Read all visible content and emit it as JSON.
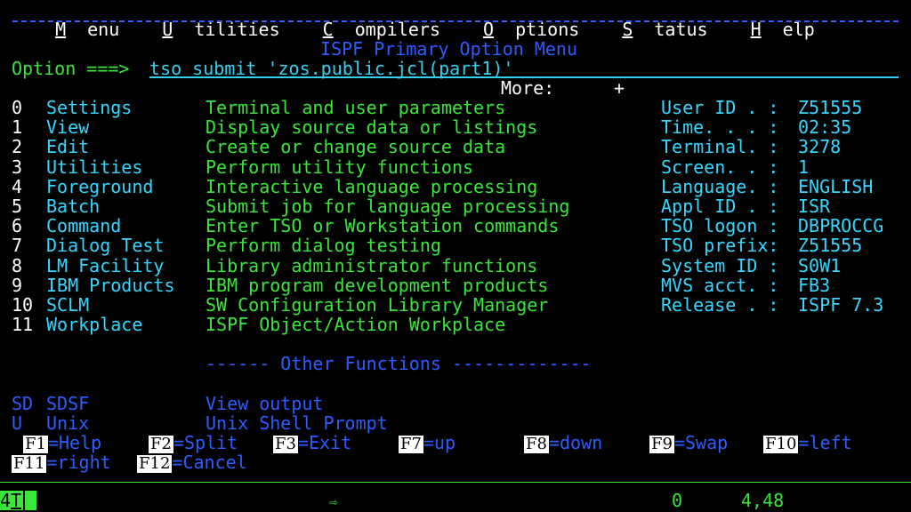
{
  "menubar": [
    {
      "mnemonic": "M",
      "rest": "enu"
    },
    {
      "mnemonic": "U",
      "rest": "tilities"
    },
    {
      "mnemonic": "C",
      "rest": "ompilers"
    },
    {
      "mnemonic": "O",
      "rest": "ptions"
    },
    {
      "mnemonic": "S",
      "rest": "tatus"
    },
    {
      "mnemonic": "H",
      "rest": "elp"
    }
  ],
  "panel_title": "ISPF Primary Option Menu",
  "option_label": "Option ===>",
  "command_value": "tso submit 'zos.public.jcl(part1)'",
  "more_label": "More:",
  "more_indicator": "+",
  "options": [
    {
      "num": "0",
      "name": "Settings",
      "desc": "Terminal and user parameters"
    },
    {
      "num": "1",
      "name": "View",
      "desc": "Display source data or listings"
    },
    {
      "num": "2",
      "name": "Edit",
      "desc": "Create or change source data"
    },
    {
      "num": "3",
      "name": "Utilities",
      "desc": "Perform utility functions"
    },
    {
      "num": "4",
      "name": "Foreground",
      "desc": "Interactive language processing"
    },
    {
      "num": "5",
      "name": "Batch",
      "desc": "Submit job for language processing"
    },
    {
      "num": "6",
      "name": "Command",
      "desc": "Enter TSO or Workstation commands"
    },
    {
      "num": "7",
      "name": "Dialog Test",
      "desc": "Perform dialog testing"
    },
    {
      "num": "8",
      "name": "LM Facility",
      "desc": "Library administrator functions"
    },
    {
      "num": "9",
      "name": "IBM Products",
      "desc": "IBM program development products"
    },
    {
      "num": "10",
      "name": "SCLM",
      "desc": "SW Configuration Library Manager"
    },
    {
      "num": "11",
      "name": "Workplace",
      "desc": "ISPF Object/Action Workplace"
    }
  ],
  "info": [
    {
      "label": "User ID . :",
      "value": "Z51555"
    },
    {
      "label": "Time. . . :",
      "value": "02:35"
    },
    {
      "label": "Terminal. :",
      "value": "3278"
    },
    {
      "label": "Screen. . :",
      "value": "1"
    },
    {
      "label": "Language. :",
      "value": "ENGLISH"
    },
    {
      "label": "Appl ID . :",
      "value": "ISR"
    },
    {
      "label": "TSO logon :",
      "value": "DBPROCCG"
    },
    {
      "label": "TSO prefix:",
      "value": "Z51555"
    },
    {
      "label": "System ID :",
      "value": "S0W1"
    },
    {
      "label": "MVS acct. :",
      "value": "FB3"
    },
    {
      "label": "Release . :",
      "value": "ISPF 7.3"
    }
  ],
  "other_functions_header": "------ Other Functions -------------",
  "other_functions": [
    {
      "code": "SD",
      "name": "SDSF",
      "desc": "View output"
    },
    {
      "code": "U",
      "name": "Unix",
      "desc": "Unix Shell Prompt"
    }
  ],
  "pfkeys_row1": [
    {
      "key": "F1",
      "label": "=Help"
    },
    {
      "key": "F2",
      "label": "=Split"
    },
    {
      "key": "F3",
      "label": "=Exit"
    },
    {
      "key": "F7",
      "label": "=up"
    },
    {
      "key": "F8",
      "label": "=down"
    },
    {
      "key": "F9",
      "label": "=Swap"
    },
    {
      "key": "F10",
      "label": "=left"
    }
  ],
  "pfkeys_row2": [
    {
      "key": "F11",
      "label": "=right"
    },
    {
      "key": "F12",
      "label": "=Cancel"
    }
  ],
  "status": {
    "session": "4",
    "session_letter": "T",
    "zero": "0",
    "cursor_pos": "4,48"
  },
  "icons": {
    "arrow": "arrow-right-icon"
  },
  "colors": {
    "background": "#000000",
    "green": "#39e639",
    "blue": "#2d5dff",
    "cyan": "#36d7ff"
  }
}
